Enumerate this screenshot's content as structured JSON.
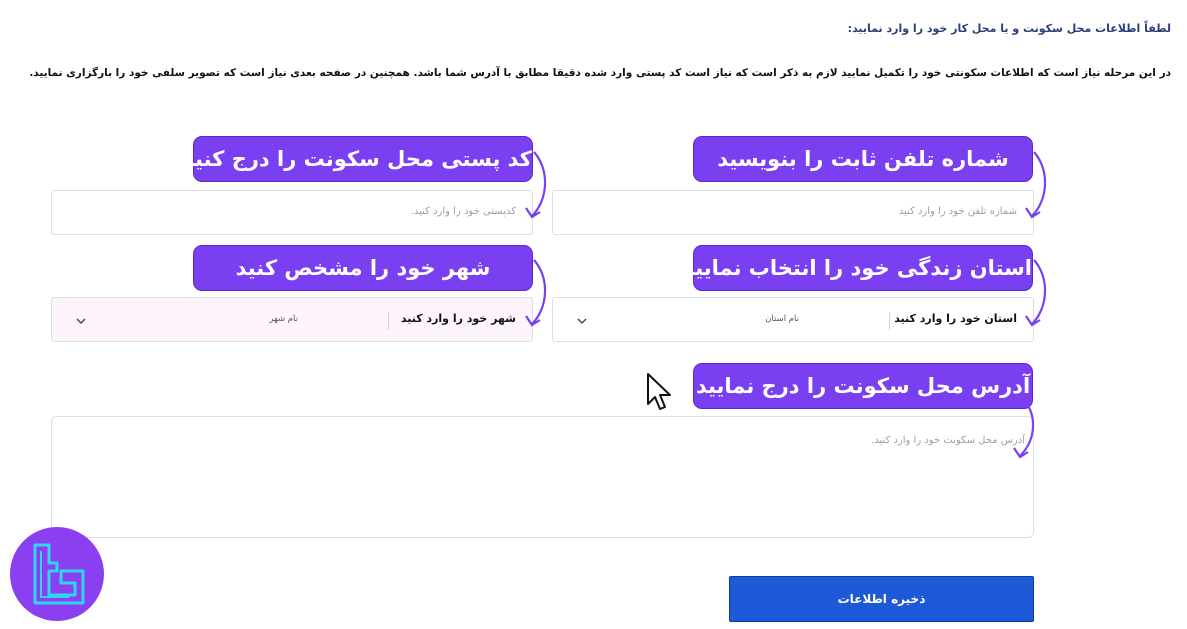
{
  "form": {
    "heading": "لطفاً اطلاعات محل سکونت و یا محل کار خود را وارد نمایید:",
    "intro": "در این مرحله نیاز است که اطلاعات سکونتی خود را تکمیل نمایید لازم به ذکر است که نیاز است کد پستی وارد شده دقیقا مطابق با آدرس شما باشد. همچنین در صفحه بعدی نیاز است که تصویر سلفی خود را بارگزاری نمایید.",
    "phone_placeholder": "شماره تلفن خود را وارد کنید",
    "postal_placeholder": "کدپستی خود را  وارد کنید.",
    "province": {
      "label": "استان خود را وارد کنید",
      "value": "نام استان"
    },
    "city": {
      "label": "شهر خود را وارد کنید",
      "value": "نام شهر"
    },
    "address_placeholder": "آدرس محل سکونت خود را وارد کنید.",
    "save_label": "ذخیره اطلاعات"
  },
  "callouts": {
    "phone": "شماره تلفن ثابت را بنویسید",
    "postal": "کد پستی محل سکونت را درج کنید",
    "province": "استان زندگی خود را انتخاب نمایید",
    "city": "شهر خود را مشخص کنید",
    "address": "آدرس محل سکونت را درج نمایید"
  },
  "colors": {
    "callout": "#7a3ff0",
    "save_button": "#1e5ad8",
    "logo": "#8a3ff0",
    "logo_glyph": "#2fd6f2"
  },
  "icons": [
    "chevron-down-icon",
    "curved-arrow-icon",
    "mouse-cursor-icon",
    "brand-logo-icon"
  ]
}
